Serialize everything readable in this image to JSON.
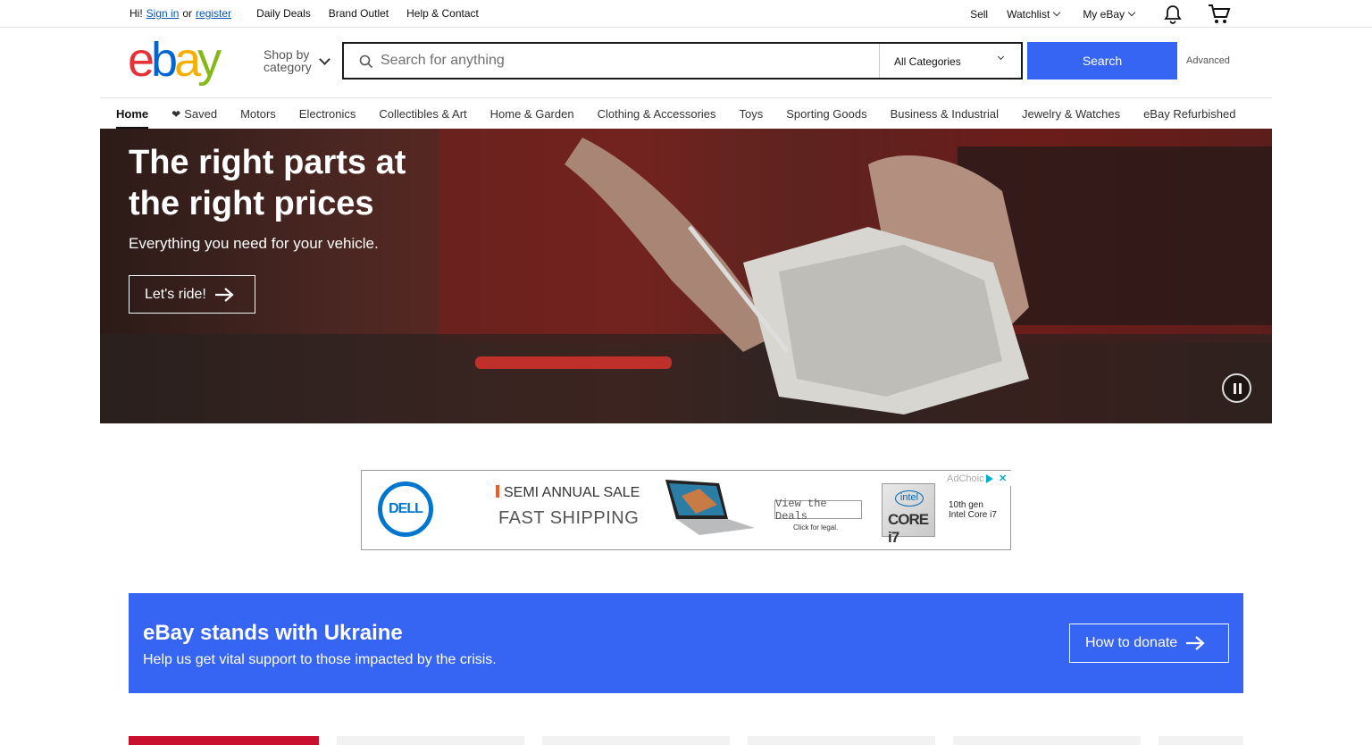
{
  "topbar": {
    "greeting": "Hi!",
    "sign_in": "Sign in",
    "or": "or",
    "register": "register",
    "links": [
      "Daily Deals",
      "Brand Outlet",
      "Help & Contact"
    ],
    "sell": "Sell",
    "watchlist": "Watchlist",
    "my_ebay": "My eBay",
    "notifications_icon": "bell-icon",
    "cart_icon": "cart-icon"
  },
  "header": {
    "logo": "ebay",
    "shop_by_line1": "Shop by",
    "shop_by_line2": "category",
    "search_placeholder": "Search for anything",
    "category_select": "All Categories",
    "search_button": "Search",
    "advanced": "Advanced"
  },
  "nav": {
    "items": [
      "Home",
      "Saved",
      "Motors",
      "Electronics",
      "Collectibles & Art",
      "Home & Garden",
      "Clothing & Accessories",
      "Toys",
      "Sporting Goods",
      "Business & Industrial",
      "Jewelry & Watches",
      "eBay Refurbished"
    ]
  },
  "hero": {
    "title": "The right parts at the right prices",
    "subtitle": "Everything you need for your vehicle.",
    "cta": "Let's ride!"
  },
  "ad": {
    "brand": "DELL",
    "headline": "SEMI ANNUAL SALE",
    "subhead": "FAST SHIPPING",
    "button": "View the Deals",
    "legal": "Click for legal.",
    "intel_logo": "intel",
    "intel_badge": "CORE i7",
    "processor_line1": "10th gen",
    "processor_line2": "Intel Core i7",
    "adchoices": "AdChoices",
    "colors": {
      "dell": "#0076ce",
      "accent": "#f15a24"
    }
  },
  "ukraine": {
    "title": "eBay stands with Ukraine",
    "subtitle": "Help us get vital support to those impacted by the crisis.",
    "button": "How to donate",
    "bg_color": "#3665f3"
  }
}
